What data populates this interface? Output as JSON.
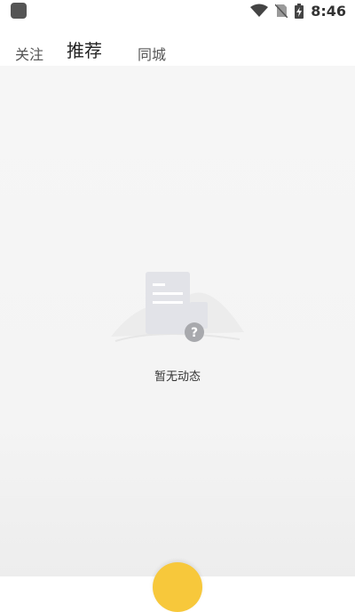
{
  "status_bar": {
    "time": "8:46",
    "icons": [
      "wifi-icon",
      "no-sim-icon",
      "battery-charging-icon"
    ]
  },
  "tabs": [
    {
      "label": "关注"
    },
    {
      "label": "推荐",
      "active": true
    },
    {
      "label": "同城"
    }
  ],
  "empty_state": {
    "message": "暂无动态",
    "icon": "no-content-question-icon"
  },
  "colors": {
    "accent": "#f7c83b",
    "background": "#f4f4f4"
  }
}
